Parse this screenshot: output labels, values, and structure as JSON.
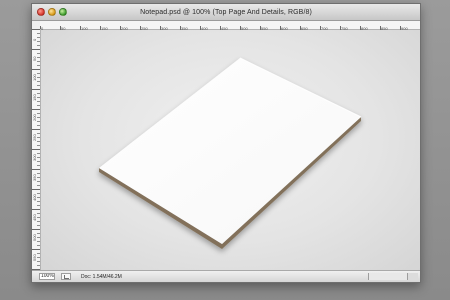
{
  "window": {
    "title": "Notepad.psd @ 100% (Top Page And Details, RGB/8)",
    "controls": {
      "close": "close-button",
      "minimize": "minimize-button",
      "zoom": "zoom-button"
    }
  },
  "rulers": {
    "top": {
      "labels": [
        "0",
        "50",
        "100",
        "150",
        "200",
        "250",
        "300",
        "350",
        "400",
        "450",
        "500",
        "550",
        "600",
        "650",
        "700",
        "750",
        "800",
        "850",
        "900"
      ]
    },
    "left": {
      "labels": [
        "0",
        "50",
        "100",
        "150",
        "200",
        "250",
        "300",
        "350",
        "400",
        "450",
        "500",
        "550",
        "600"
      ]
    }
  },
  "statusbar": {
    "zoom": "100%",
    "doc_info": "Doc: 1.54M/46.2M"
  },
  "colors": {
    "paper_top": "#ffffff",
    "paper_edge": "#7d6a52",
    "canvas_center": "#f0f0f0",
    "canvas_edge": "#d5d5d5"
  }
}
